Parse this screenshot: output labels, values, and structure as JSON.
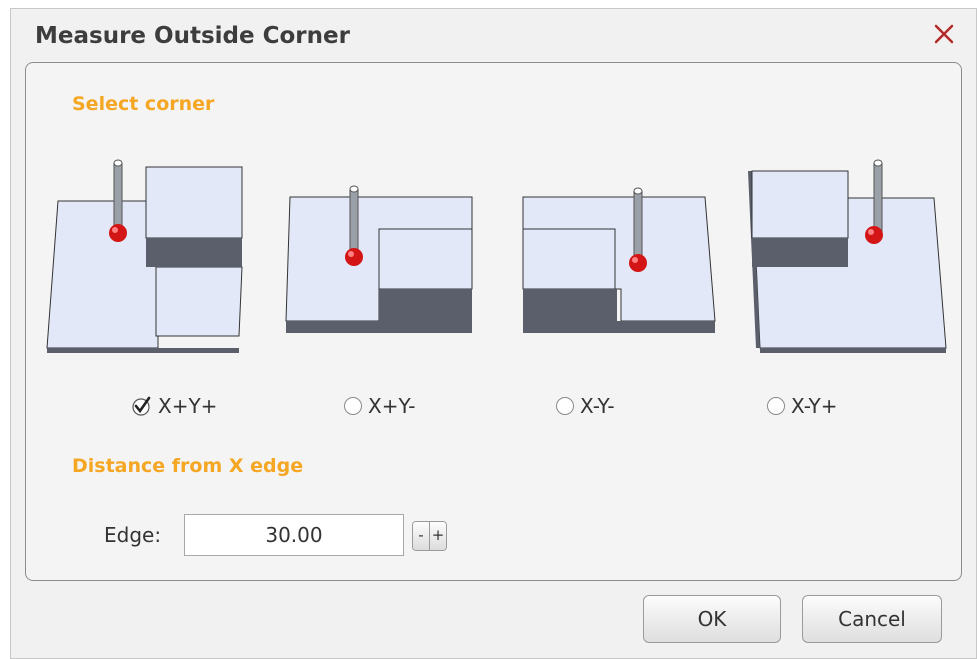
{
  "dialog": {
    "title": "Measure Outside Corner"
  },
  "section_corner": {
    "heading": "Select corner",
    "options": [
      {
        "label": "X+Y+",
        "selected": true
      },
      {
        "label": "X+Y-",
        "selected": false
      },
      {
        "label": "X-Y-",
        "selected": false
      },
      {
        "label": "X-Y+",
        "selected": false
      }
    ]
  },
  "section_distance": {
    "heading": "Distance from X edge",
    "edge_label": "Edge:",
    "edge_value": "30.00",
    "minus_label": "-",
    "plus_label": "+"
  },
  "buttons": {
    "ok": "OK",
    "cancel": "Cancel"
  },
  "colors": {
    "accent": "#f5a623",
    "close": "#b52a2a",
    "block_top": "#e2e8f8",
    "block_side": "#5a5f6b",
    "probe_ball": "#d41515"
  },
  "icons": {
    "close": "close-icon",
    "checked": "checkmark-icon",
    "unchecked": "radio-icon"
  }
}
